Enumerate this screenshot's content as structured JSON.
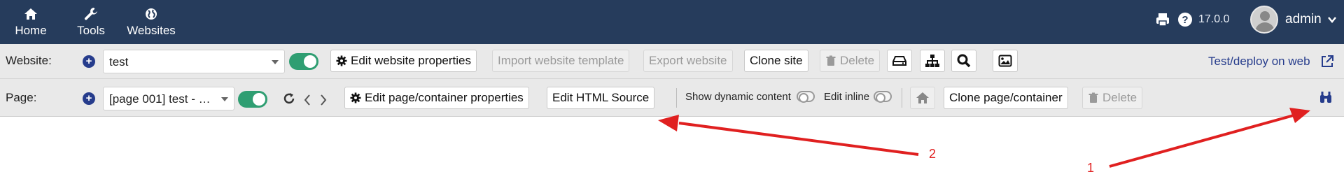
{
  "topbar": {
    "nav": [
      {
        "label": "Home",
        "icon": "home-icon"
      },
      {
        "label": "Tools",
        "icon": "wrench-icon"
      },
      {
        "label": "Websites",
        "icon": "globe-icon"
      }
    ],
    "version": "17.0.0",
    "user": "admin"
  },
  "website_bar": {
    "label": "Website:",
    "selected": "test",
    "edit_properties": "Edit website properties",
    "import_template": "Import website template",
    "export": "Export website",
    "clone": "Clone site",
    "delete": "Delete",
    "deploy_link": "Test/deploy on web"
  },
  "page_bar": {
    "label": "Page:",
    "selected": "[page 001] test - …",
    "edit_properties": "Edit page/container properties",
    "edit_html": "Edit HTML Source",
    "show_dynamic": "Show dynamic content",
    "edit_inline": "Edit inline",
    "clone": "Clone page/container",
    "delete": "Delete"
  },
  "annotations": {
    "a1": "1",
    "a2": "2"
  },
  "colors": {
    "topbar": "#263c5c",
    "toggle_on": "#2f9e72",
    "annotation": "#e02020",
    "link": "#263c8c"
  }
}
